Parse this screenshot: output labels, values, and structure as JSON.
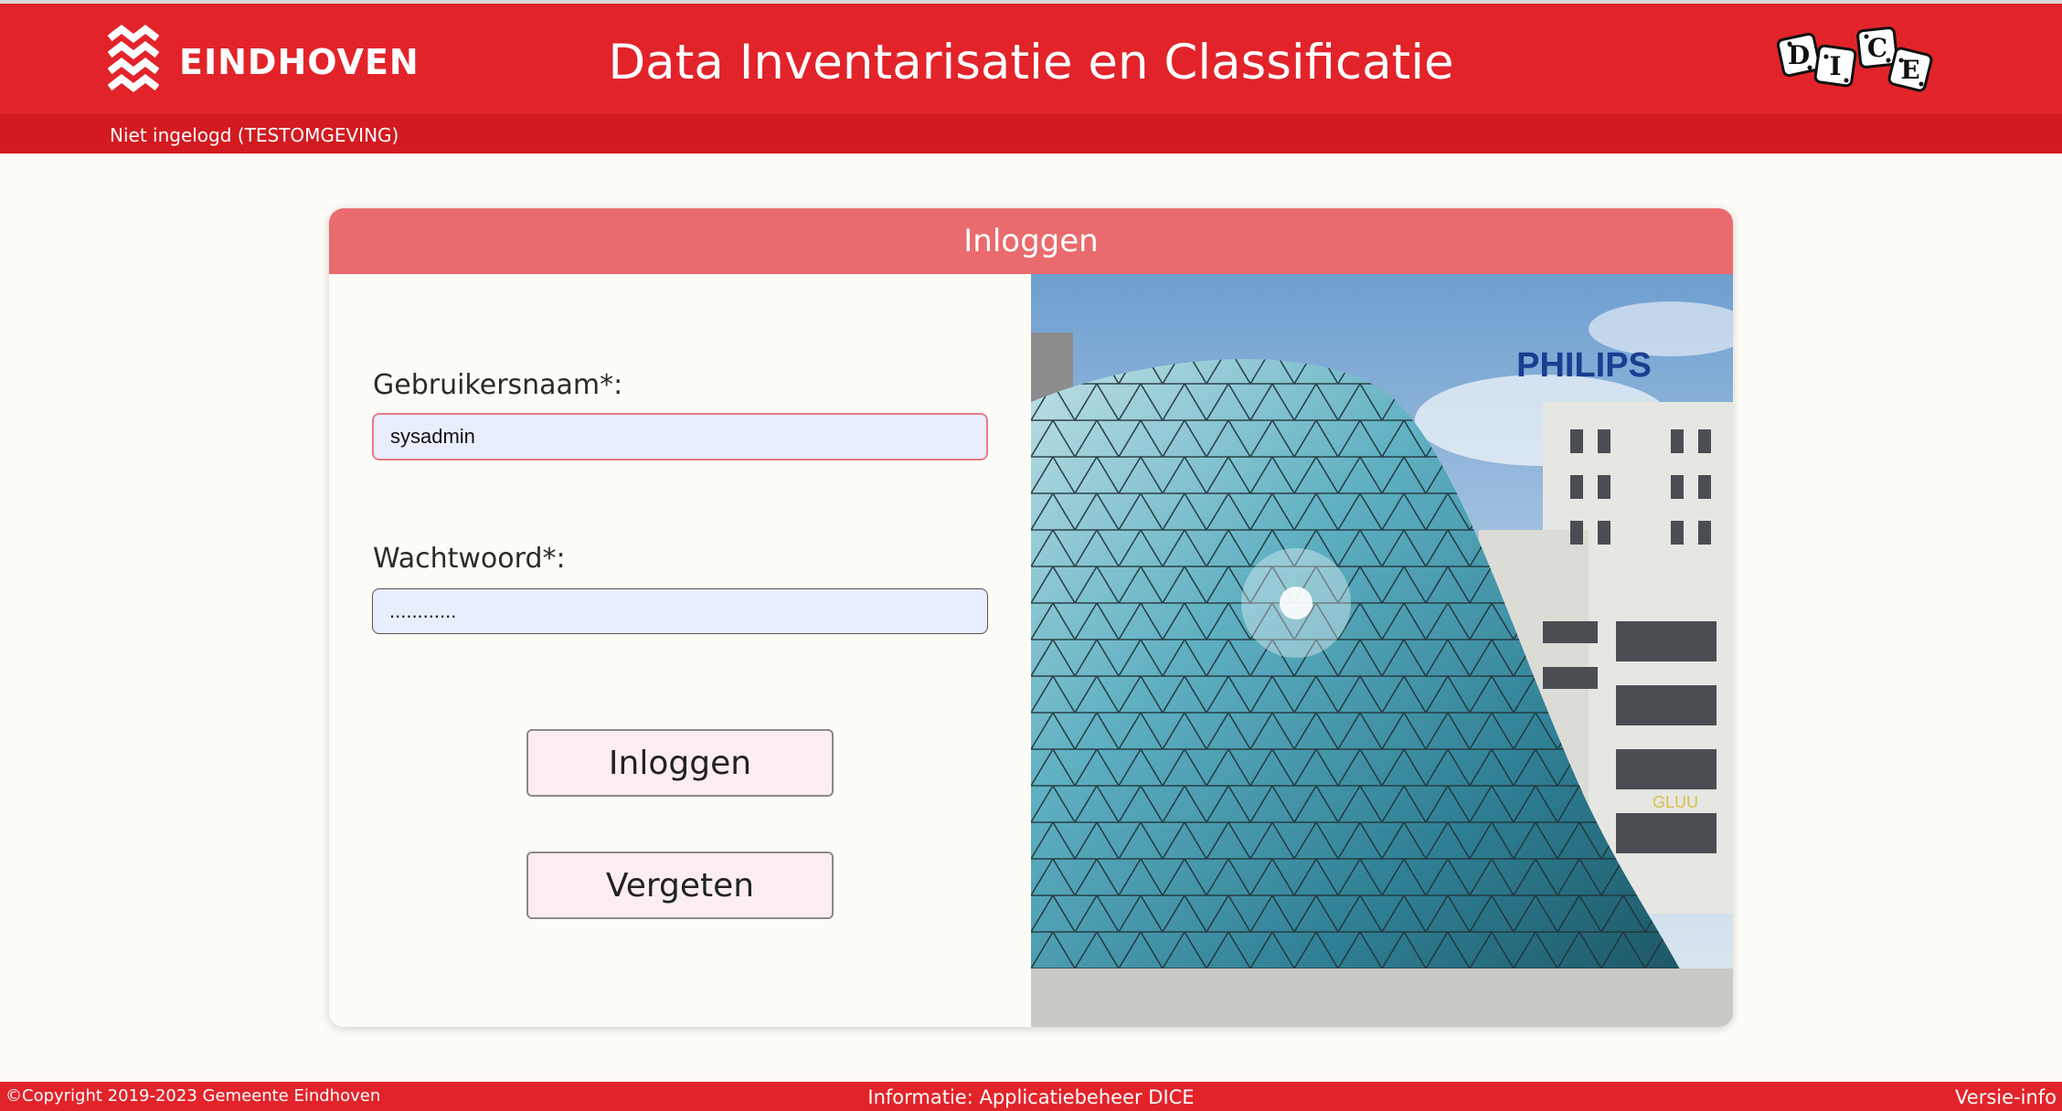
{
  "header": {
    "logo_text": "EINDHOVEN",
    "title": "Data Inventarisatie en Classificatie",
    "dice_letters": [
      "D",
      "I",
      "C",
      "E"
    ],
    "user_status": "Niet ingelogd (TESTOMGEVING)"
  },
  "login": {
    "title": "Inloggen",
    "username_label": "Gebruikersnaam*:",
    "username_value": "sysadmin",
    "password_label": "Wachtwoord*:",
    "password_value": "............",
    "login_button": "Inloggen",
    "forgot_button": "Vergeten"
  },
  "photo": {
    "sign_text": "PHILIPS",
    "shop_text": "GLUU"
  },
  "footer": {
    "copyright": "©Copyright 2019-2023 Gemeente Eindhoven",
    "info": "Informatie: Applicatiebeheer DICE",
    "version_link": "Versie-info"
  },
  "colors": {
    "brand_red": "#e2242a",
    "card_header": "#ea6b6d",
    "input_bg": "#e8eefc",
    "focus_border": "#e97b80"
  }
}
